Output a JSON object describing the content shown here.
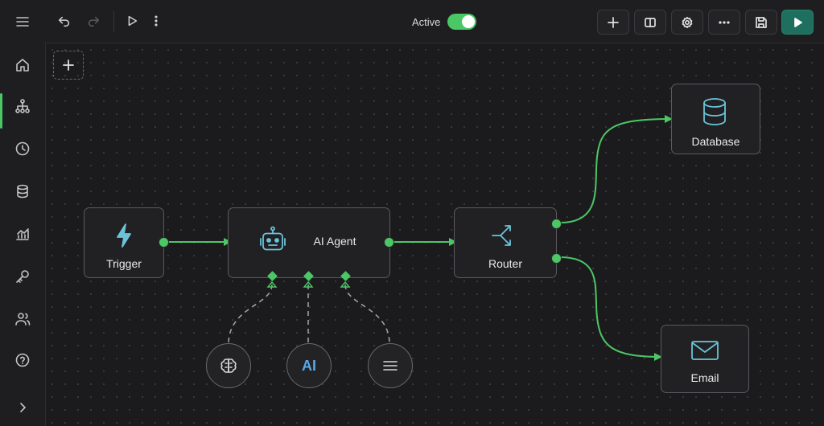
{
  "topbar": {
    "active_label": "Active",
    "active_state": true
  },
  "sidebar": {
    "items": [
      {
        "name": "home-icon"
      },
      {
        "name": "workflows-icon",
        "active": true
      },
      {
        "name": "clock-icon"
      },
      {
        "name": "database-icon"
      },
      {
        "name": "analytics-icon"
      },
      {
        "name": "key-icon"
      },
      {
        "name": "users-icon"
      },
      {
        "name": "help-icon"
      },
      {
        "name": "chevron-right-icon"
      }
    ]
  },
  "nodes": {
    "trigger": {
      "label": "Trigger",
      "icon": "lightning-icon"
    },
    "agent": {
      "label": "AI Agent",
      "icon": "robot-icon"
    },
    "router": {
      "label": "Router",
      "icon": "split-icon"
    },
    "database": {
      "label": "Database",
      "icon": "database-icon"
    },
    "email": {
      "label": "Email",
      "icon": "mail-icon"
    }
  },
  "tools": {
    "memory": {
      "icon": "brain-icon"
    },
    "model": {
      "text": "AI"
    },
    "parser": {
      "icon": "menu-lines-icon"
    }
  },
  "colors": {
    "accent": "#4cc766",
    "icon": "#6cc3d8",
    "run_button": "#1f6f5f",
    "ai_text": "#5aa9e6"
  }
}
